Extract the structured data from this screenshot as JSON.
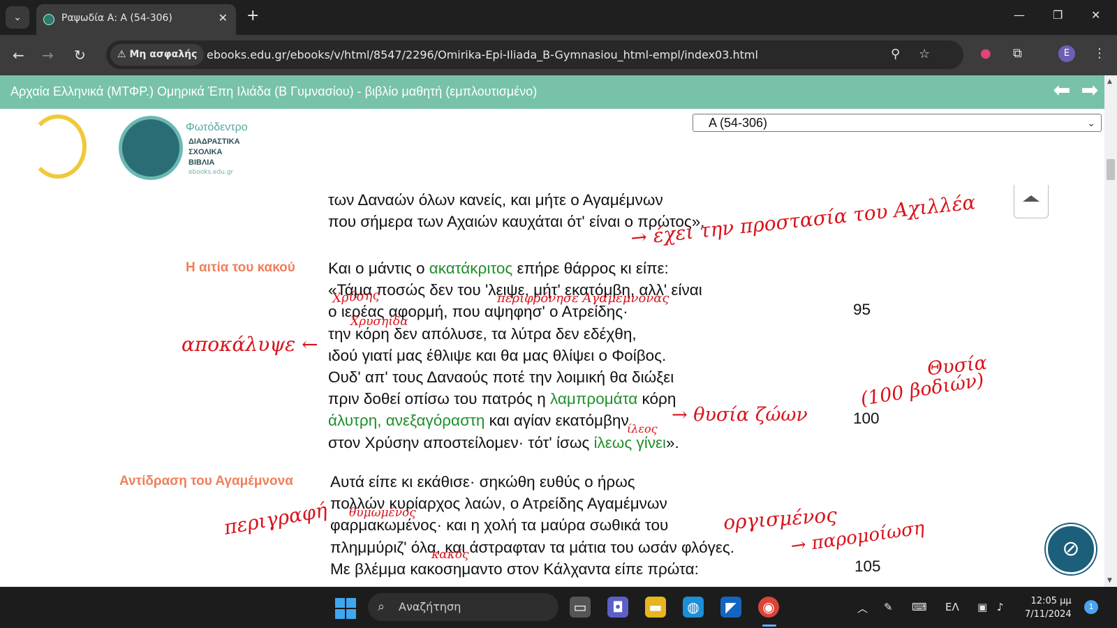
{
  "browser": {
    "tab_title": "Ραψωδία Α: Α (54-306)",
    "security_label": "Μη ασφαλής",
    "url": "ebooks.edu.gr/ebooks/v/html/8547/2296/Omirika-Epi-Iliada_B-Gymnasiou_html-empl/index03.html",
    "profile_initial": "E"
  },
  "site": {
    "title": "Αρχαία Ελληνικά (ΜΤΦΡ.) Ομηρικά Έπη Ιλιάδα (Β Γυμνασίου) - βιβλίο μαθητή (εμπλουτισμένο)",
    "logo_name": "Φωτόδεντρο",
    "logo_sub_1": "ΔΙΑΔΡΑΣΤΙΚΑ",
    "logo_sub_2": "ΣΧΟΛΙΚΑ",
    "logo_sub_3": "ΒΙΒΛΙΑ",
    "logo_url": "ebooks.edu.gr",
    "chapter_selected": "Α (54-306)"
  },
  "text": {
    "block0": [
      "των Δαναών όλων κανείς, και μήτε ο Αγαμέμνων",
      "που σήμερα των Αχαιών καυχάται ότ' είναι ο πρώτος»."
    ],
    "head1": "Η αιτία του κακού",
    "b1_l1_a": "Και ο μάντις ο ",
    "b1_l1_g": "ακατάκριτος",
    "b1_l1_b": " επήρε θάρρος κι είπε:",
    "b1_l2": "«Τάμα ποσώς δεν του 'λειψε, μήτ' εκατόμβη, αλλ' είναι",
    "b1_l3": "ο ιερέας αφορμή, που αψηφησ' ο Ατρείδης·",
    "b1_l4": "την κόρη δεν απόλυσε, τα λύτρα δεν εδέχθη,",
    "b1_l5": "ιδού γιατί μας έθλιψε και θα μας θλίψει ο Φοίβος.",
    "b1_l6": "Ουδ' απ' τους Δαναούς ποτέ την λοιμική θα διώξει",
    "b1_l7_a": "πριν δοθεί οπίσω του πατρός η ",
    "b1_l7_g": "λαμπρομάτα",
    "b1_l7_b": " κόρη",
    "b1_l8_g": "άλυτρη, ανεξαγόραστη",
    "b1_l8_b": " και αγίαν εκατόμβην",
    "b1_l9_a": "στον Χρύσην αποστείλομεν· τότ' ίσως ",
    "b1_l9_g": "ίλεως γίνει",
    "b1_l9_b": "».",
    "num95": "95",
    "num100": "100",
    "head2": "Αντίδραση του Αγαμέμνονα",
    "b2_l1": "Αυτά είπε κι εκάθισε· σηκώθη ευθύς ο ήρως",
    "b2_l2": "πολλών κυρίαρχος λαών, ο Ατρείδης Αγαμέμνων",
    "b2_l3": "φαρμακωμένος· και η χολή τα μαύρα σωθικά του",
    "b2_l4": "πλημμύριζ' όλα, και άστραφταν τα μάτια του ωσάν φλόγες.",
    "b2_l5": "Με βλέμμα κακοσημαντο στον Κάλχαντα είπε πρώτα:",
    "num105": "105"
  },
  "annotations": {
    "a1": "→ έχει την προστασία του Αχιλλέα",
    "a2": "Χρύσης",
    "a3": "περιφρόνησε Αγαμέμνονας",
    "a4": "Χρυσηίδα",
    "a5": "αποκάλυψε ←",
    "a6": "Θυσία",
    "a7": "(100 βοδιών)",
    "a8": "→ θυσία ζώων",
    "a9": "ίλεος",
    "a10": "περιγραφή",
    "a11": "θυμωμένος",
    "a12": "οργισμένος",
    "a13": "→ παρομοίωση",
    "a14": "κακός"
  },
  "taskbar": {
    "search_placeholder": "Αναζήτηση",
    "lang": "ΕΛ",
    "time": "12:05 μμ",
    "date": "7/11/2024",
    "notifications": "1"
  },
  "colors": {
    "header_bg": "#77c2a9",
    "sidehead": "#f07f5d",
    "green_word": "#1f8f2a",
    "ink": "#d9121b"
  }
}
